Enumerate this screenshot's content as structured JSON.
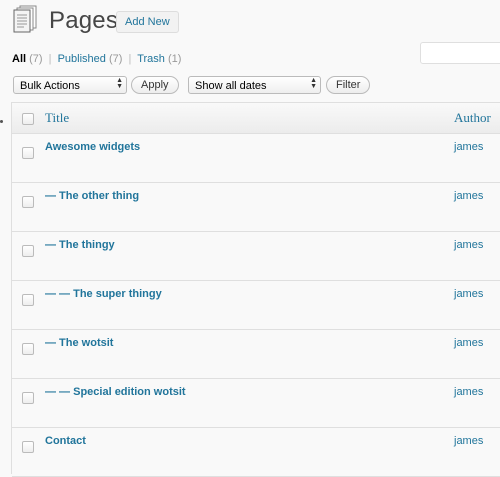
{
  "header": {
    "title": "Pages",
    "add_new_label": "Add New",
    "icon": "pages-icon"
  },
  "filters": [
    {
      "label": "All",
      "count": "(7)",
      "current": true
    },
    {
      "label": "Published",
      "count": "(7)",
      "current": false
    },
    {
      "label": "Trash",
      "count": "(1)",
      "current": false
    }
  ],
  "separator": "|",
  "actions": {
    "bulk_select": "Bulk Actions",
    "apply_label": "Apply",
    "dates_select": "Show all dates",
    "filter_label": "Filter"
  },
  "table": {
    "columns": {
      "title": "Title",
      "author": "Author"
    },
    "rows": [
      {
        "title": "Awesome widgets",
        "author": "james"
      },
      {
        "title": "— The other thing",
        "author": "james"
      },
      {
        "title": "— The thingy",
        "author": "james"
      },
      {
        "title": "— — The super thingy",
        "author": "james"
      },
      {
        "title": "— The wotsit",
        "author": "james"
      },
      {
        "title": "— — Special edition wotsit",
        "author": "james"
      },
      {
        "title": "Contact",
        "author": "james"
      }
    ]
  },
  "colors": {
    "link": "#21759b",
    "text": "#333333",
    "border": "#dfdfdf"
  }
}
